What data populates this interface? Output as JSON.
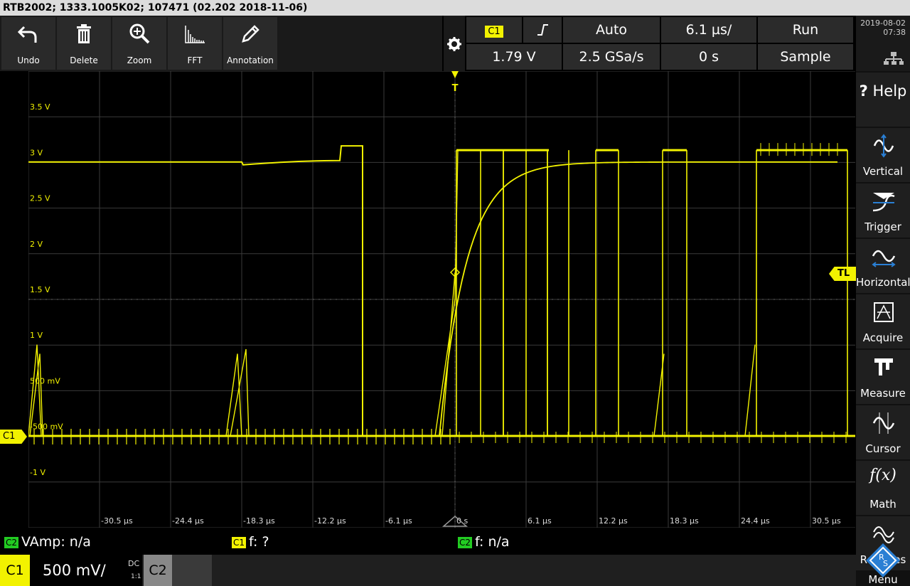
{
  "title": "RTB2002; 1333.1005K02; 107471 (02.202 2018-11-06)",
  "toolbar": [
    {
      "label": "Undo",
      "icon": "undo-icon"
    },
    {
      "label": "Delete",
      "icon": "trash-icon"
    },
    {
      "label": "Zoom",
      "icon": "zoom-icon"
    },
    {
      "label": "FFT",
      "icon": "fft-icon"
    },
    {
      "label": "Annotation",
      "icon": "pencil-icon"
    }
  ],
  "header": {
    "channel": "C1",
    "slope_icon": "rising-edge-icon",
    "trigger_mode": "Auto",
    "timebase": "6.1 µs/",
    "run_state": "Run",
    "trigger_level": "1.79 V",
    "sample_rate": "2.5 GSa/s",
    "position": "0 s",
    "acquisition": "Sample"
  },
  "clock": {
    "date": "2019-08-02",
    "time": "07:38"
  },
  "sidebar": [
    {
      "label": "Help",
      "prefix": "?"
    },
    {
      "label": "Vertical"
    },
    {
      "label": "Trigger"
    },
    {
      "label": "Horizontal"
    },
    {
      "label": "Acquire"
    },
    {
      "label": "Measure"
    },
    {
      "label": "Cursor"
    },
    {
      "label": "Math"
    },
    {
      "label": "References",
      "visible": "Re      es"
    },
    {
      "label": "Menu"
    }
  ],
  "y_labels": [
    "3.5 V",
    "3 V",
    "2.5 V",
    "2 V",
    "1.5 V",
    "1 V",
    "500 mV",
    "-500 mV",
    "-1 V"
  ],
  "x_labels": [
    "-30.5 µs",
    "-24.4 µs",
    "-18.3 µs",
    "-12.2 µs",
    "-6.1 µs",
    "0 s",
    "6.1 µs",
    "12.2 µs",
    "18.3 µs",
    "24.4 µs",
    "30.5 µs"
  ],
  "markers": {
    "channel": "C1",
    "trigger_level": "TL",
    "trigger_pos": "T"
  },
  "measurements": [
    {
      "badge": "C2",
      "badge_color": "#22cc22",
      "text": "VAmp: n/a"
    },
    {
      "badge": "C1",
      "badge_color": "#f2f200",
      "text": "f: ?"
    },
    {
      "badge": "C2",
      "badge_color": "#22cc22",
      "text": "f: n/a"
    }
  ],
  "bottom": {
    "ch1": "C1",
    "scale": "500 mV/",
    "coupling": "DC",
    "probe": "1:1",
    "ch2": "C2"
  },
  "colors": {
    "trace": "#f2f200",
    "grid": "#3a3a3a",
    "accent": "#2a7fd4"
  }
}
